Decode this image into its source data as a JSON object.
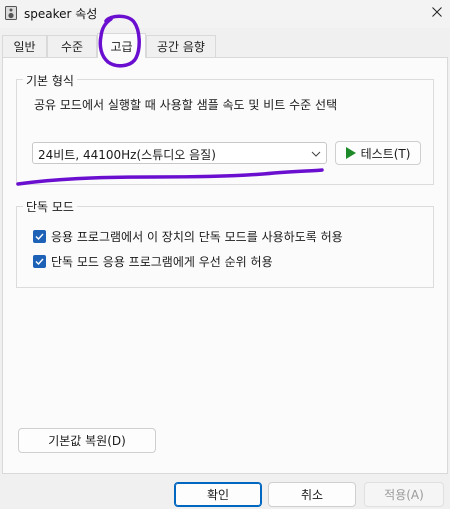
{
  "window": {
    "title": "speaker 속성",
    "icons": {
      "app": "speaker-icon",
      "close": "close-icon"
    }
  },
  "tabs": [
    {
      "label": "일반",
      "selected": false
    },
    {
      "label": "수준",
      "selected": false
    },
    {
      "label": "고급",
      "selected": true
    },
    {
      "label": "공간 음향",
      "selected": false
    }
  ],
  "default_format": {
    "group_label": "기본 형식",
    "description": "공유 모드에서 실행할 때 사용할 샘플 속도 및 비트 수준 선택",
    "selected_value": "24비트, 44100Hz(스튜디오 음질)",
    "test_button_label": "테스트(T)"
  },
  "exclusive_mode": {
    "group_label": "단독 모드",
    "options": [
      {
        "label": "응용 프로그램에서 이 장치의 단독 모드를 사용하도록 허용",
        "checked": true
      },
      {
        "label": "단독 모드 응용 프로그램에게 우선 순위 허용",
        "checked": true
      }
    ]
  },
  "restore_defaults_label": "기본값 복원(D)",
  "dialog_buttons": {
    "ok": "확인",
    "cancel": "취소",
    "apply": "적용(A)"
  },
  "colors": {
    "annotation": "#6a0fcf",
    "accent": "#1e62b8",
    "play": "#1d8a2a"
  }
}
